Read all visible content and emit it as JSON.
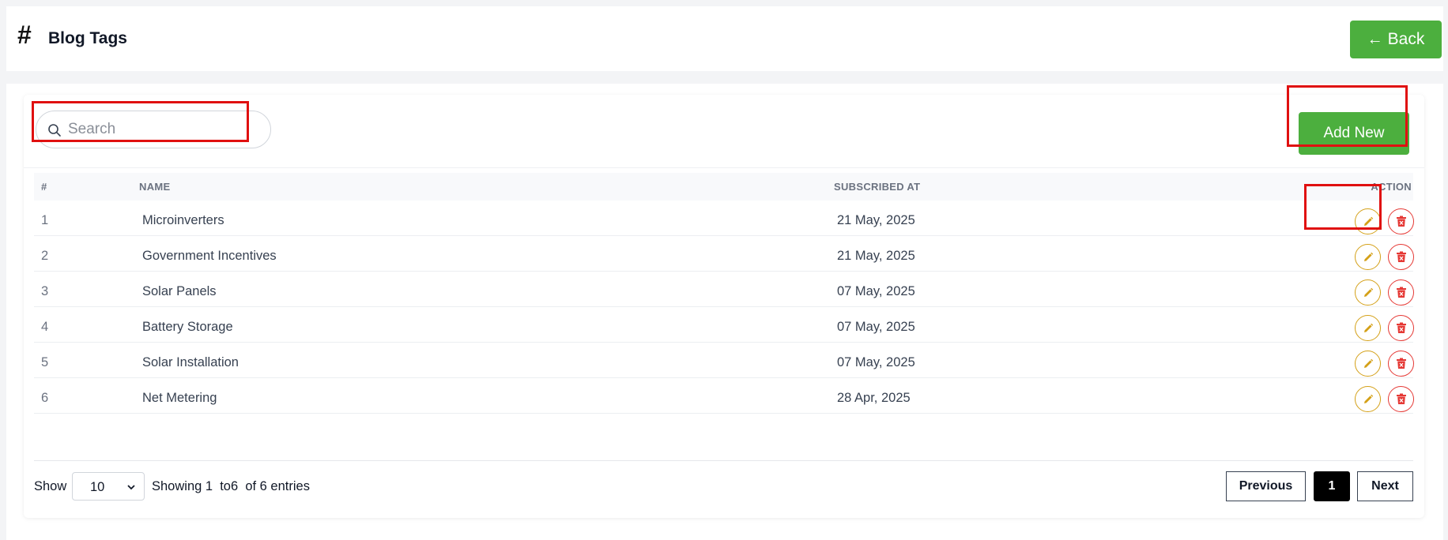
{
  "header": {
    "title": "Blog Tags",
    "back_label": "Back"
  },
  "search": {
    "placeholder": "Search",
    "value": ""
  },
  "toolbar": {
    "add_new_label": "Add New"
  },
  "table": {
    "columns": [
      "#",
      "NAME",
      "SUBSCRIBED AT",
      "ACTION"
    ],
    "rows": [
      {
        "num": "1",
        "name": "Microinverters",
        "date": "21 May, 2025"
      },
      {
        "num": "2",
        "name": "Government Incentives",
        "date": "21 May, 2025"
      },
      {
        "num": "3",
        "name": "Solar Panels",
        "date": "07 May, 2025"
      },
      {
        "num": "4",
        "name": "Battery Storage",
        "date": "07 May, 2025"
      },
      {
        "num": "5",
        "name": "Solar Installation",
        "date": "07 May, 2025"
      },
      {
        "num": "6",
        "name": "Net Metering",
        "date": "28 Apr, 2025"
      }
    ]
  },
  "footer": {
    "show_label": "Show",
    "page_size": "10",
    "entries_info": "Showing 1  to6  of 6 entries",
    "prev_label": "Previous",
    "current_page": "1",
    "next_label": "Next"
  },
  "colors": {
    "primary_green": "#4caf3e",
    "edit_accent": "#d4a017",
    "delete_accent": "#e53935",
    "highlight_red": "#e01010"
  },
  "icons": {
    "title": "hash-icon",
    "back": "arrow-left-icon",
    "search": "search-icon",
    "edit": "pencil-icon",
    "delete": "trash-icon",
    "select": "chevron-down-icon"
  }
}
